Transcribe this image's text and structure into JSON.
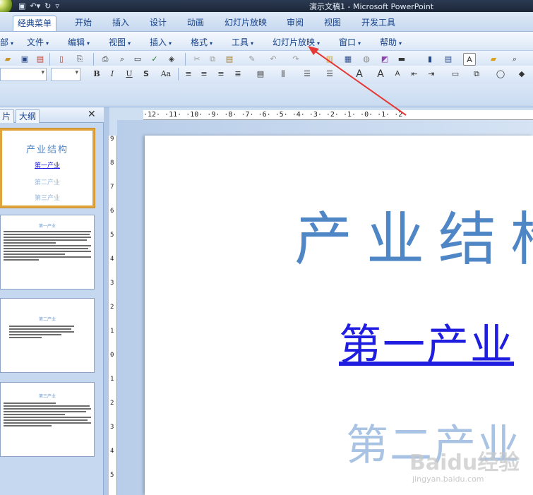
{
  "window": {
    "title": "演示文稿1 - Microsoft PowerPoint"
  },
  "ribbon_tabs": [
    {
      "label": "经典菜单",
      "active": true
    },
    {
      "label": "开始"
    },
    {
      "label": "插入"
    },
    {
      "label": "设计"
    },
    {
      "label": "动画"
    },
    {
      "label": "幻灯片放映"
    },
    {
      "label": "审阅"
    },
    {
      "label": "视图"
    },
    {
      "label": "开发工具"
    }
  ],
  "menubar": {
    "partial_left": "部",
    "items": [
      "文件",
      "编辑",
      "视图",
      "插入",
      "格式",
      "工具",
      "幻灯片放映",
      "窗口",
      "帮助"
    ]
  },
  "toolbar2": {
    "bold": "B",
    "italic": "I",
    "underline": "U",
    "shadow": "S",
    "change_case": "Aa"
  },
  "thumbnail_pane": {
    "tab_slides": "片",
    "tab_outline": "大纲",
    "close": "✕",
    "slides": [
      {
        "title": "产业结构",
        "lines": [
          "第一产业",
          "第二产业",
          "第三产业"
        ]
      },
      {
        "title": "第一产业"
      },
      {
        "title": "第二产业"
      },
      {
        "title": "第三产业"
      }
    ]
  },
  "ruler": {
    "horizontal": "·12· ·11· ·10· ·9· ·8· ·7· ·6· ·5· ·4· ·3· ·2· ·1· ·0· ·1· ·2",
    "vertical": [
      "9",
      "8",
      "7",
      "6",
      "5",
      "4",
      "3",
      "2",
      "1",
      "0",
      "1",
      "2",
      "3",
      "4",
      "5"
    ]
  },
  "slide": {
    "title": "产业结构",
    "line1": "第一产业",
    "line2": "第二产业"
  },
  "watermark": {
    "logo": "Baidu经验",
    "sub": "jingyan.baidu.com"
  },
  "colors": {
    "title_blue": "#4f86c6",
    "link_blue": "#1f1ee0",
    "visited_blue": "#a8c3e3",
    "selection_orange": "#e0a43c",
    "arrow_red": "#e53935"
  }
}
